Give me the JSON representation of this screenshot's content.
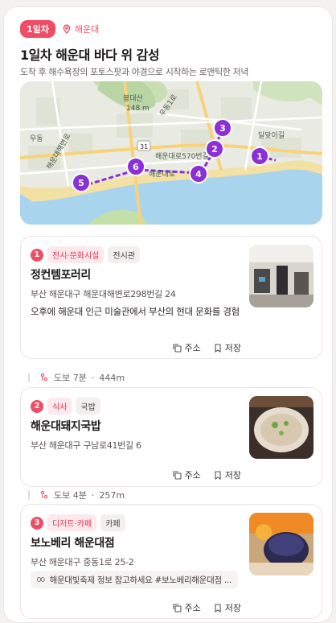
{
  "header": {
    "day_badge": "1일차",
    "location": "해운대",
    "title": "1일차 해운대 바다 위 감성",
    "subtitle": "도착 후 해수욕장의 포토스팟과 야경으로 시작하는 로맨틱한 저녁"
  },
  "map": {
    "labels": {
      "mountain": "봉대산",
      "mountain_elev": "148 m",
      "road_route": "31",
      "road1": "해운대로570번길",
      "road2": "해운대해변로",
      "area1": "우동",
      "area2": "달맞이길",
      "area3": "우동1로",
      "area4": "해운대로"
    },
    "markers": [
      "1",
      "2",
      "3",
      "4",
      "5",
      "6"
    ]
  },
  "places": [
    {
      "num": "1",
      "category": "전시·문화시설",
      "subcategory": "전시관",
      "name": "정컨템포러리",
      "address": "부산 해운대구 해운대해변로298번길 24",
      "desc": "오후에 해운대 인근 미술관에서 부산의 현대 문화를 경험",
      "action_addr": "주소",
      "action_save": "저장"
    },
    {
      "num": "2",
      "category": "식사",
      "subcategory": "국밥",
      "name": "해운대돼지국밥",
      "address": "부산 해운대구 구남로41번길 6",
      "action_addr": "주소",
      "action_save": "저장"
    },
    {
      "num": "3",
      "category": "디저트·카페",
      "subcategory": "카페",
      "name": "보노베리 해운대점",
      "address": "부산 해운대구 중동1로 25-2",
      "tip": "해운대빛축제 정보 참고하세요 #보노베리해운대점 ...",
      "action_addr": "주소",
      "action_save": "저장"
    }
  ],
  "walks": [
    {
      "mode": "도보 7분",
      "distance": "444m"
    },
    {
      "mode": "도보 4분",
      "distance": "257m"
    }
  ],
  "colors": {
    "accent": "#ee4d65",
    "route": "#8b2fd6",
    "sea": "#a9d4ee"
  }
}
